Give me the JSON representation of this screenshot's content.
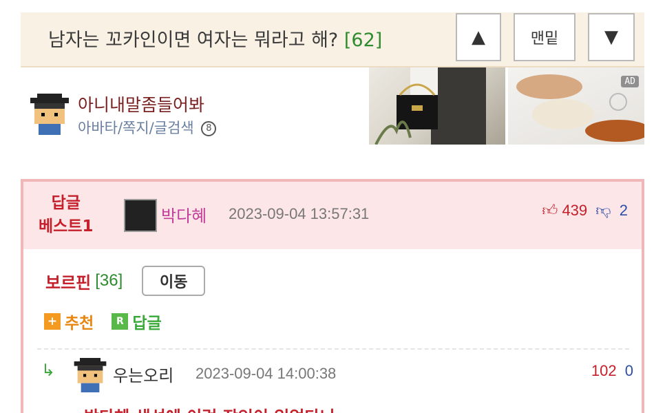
{
  "header": {
    "title": "남자는 꼬카인이면 여자는 뭐라고 해?",
    "comment_count": "[62]",
    "bottom_label": "맨밑",
    "up_icon": "triangle-up-icon",
    "down_icon": "triangle-down-icon"
  },
  "author": {
    "name": "아니내말좀들어봐",
    "links": "아바타/쪽지/글검색",
    "badge_icon": "level-badge-icon",
    "badge_text": "8"
  },
  "ad": {
    "tag": "AD"
  },
  "best_comment": {
    "label_line1": "답글",
    "label_line2": "베스트1",
    "user": "박다혜",
    "time": "2023-09-04 13:57:31",
    "up_count": "439",
    "down_count": "2",
    "game_name": "보르핀",
    "game_count": "[36]",
    "move_label": "이동",
    "recommend_label": "추천",
    "reply_label": "답글",
    "recommend_icon": "plus-square-icon",
    "reply_icon": "r-square-icon",
    "reply_icon_text": "R"
  },
  "reply": {
    "user": "우는오리",
    "time": "2023-09-04 14:00:38",
    "up_count": "102",
    "down_count": "0",
    "cut_text": "박다혜 생선에 이런 장인이 있었다니"
  },
  "colors": {
    "accent_red": "#c41f2a",
    "green": "#2e8b2e",
    "card_border": "#f0b7b9",
    "title_bg": "#f9f1e4"
  }
}
